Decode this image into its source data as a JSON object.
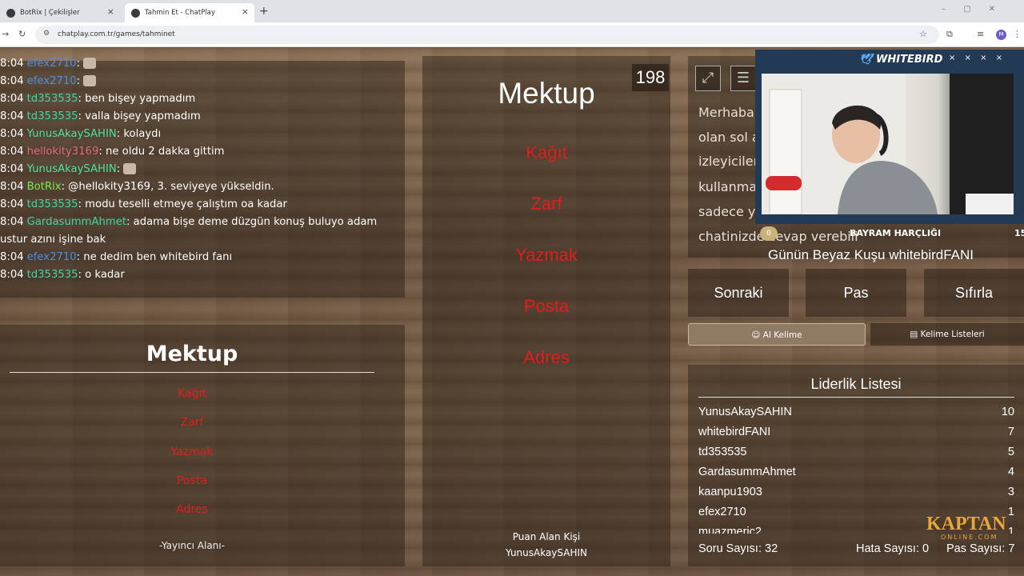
{
  "browser": {
    "tabs": [
      {
        "title": "BotRix | Çekilişler"
      },
      {
        "title": "Tahmin Et - ChatPlay"
      }
    ],
    "url": "chatplay.com.tr/games/tahminet",
    "profile_initial": "M"
  },
  "chat": {
    "messages": [
      {
        "time": "8:04",
        "user": "efex2710",
        "text": ":",
        "color": "#4a8fe8",
        "emote": true
      },
      {
        "time": "8:04",
        "user": "efex2710",
        "text": ":",
        "color": "#4a8fe8",
        "emote": true
      },
      {
        "time": "8:04",
        "user": "td353535",
        "text": ": ben bişey yapmadım",
        "color": "#3fd6a3"
      },
      {
        "time": "8:04",
        "user": "td353535",
        "text": ": valla bişey yapmadım",
        "color": "#3fd6a3"
      },
      {
        "time": "8:04",
        "user": "YunusAkaySAHIN",
        "text": ": kolaydı",
        "color": "#4fe39c"
      },
      {
        "time": "8:04",
        "user": "hellokity3169",
        "text": ": ne oldu 2 dakka gittim",
        "color": "#e86b7a"
      },
      {
        "time": "8:04",
        "user": "YunusAkaySAHIN",
        "text": ":",
        "color": "#4fe39c",
        "emote": true
      },
      {
        "time": "8:04",
        "user": "BotRix",
        "text": ": @hellokity3169, 3. seviyeye yükseldin.",
        "color": "#7ee84f"
      },
      {
        "time": "8:04",
        "user": "td353535",
        "text": ": modu teselli etmeye çalıştım oa kadar",
        "color": "#3fd6a3"
      },
      {
        "time": "8:04",
        "user": "GardasummAhmet",
        "text": ": adama bişe deme düzgün konuş buluyo adam",
        "color": "#3fd6a3"
      },
      {
        "time": "",
        "user": "",
        "text": "ustur azını işine bak",
        "color": "#ffffff"
      },
      {
        "time": "8:04",
        "user": "efex2710",
        "text": ": ne dedim ben whitebird fanı",
        "color": "#4a8fe8"
      },
      {
        "time": "8:04",
        "user": "td353535",
        "text": ": o kadar",
        "color": "#3fd6a3"
      }
    ]
  },
  "streamer": {
    "word": "Mektup",
    "forbidden": [
      "Kağıt",
      "Zarf",
      "Yazmak",
      "Posta",
      "Adres"
    ],
    "footer": "-Yayıncı Alanı-"
  },
  "center": {
    "word": "Mektup",
    "timer": "198",
    "forbidden": [
      "Kağıt",
      "Zarf",
      "Yazmak",
      "Posta",
      "Adres"
    ],
    "scorer_label": "Puan Alan Kişi",
    "scorer": "YunusAkaySAHIN"
  },
  "info": {
    "lines": [
      "Merhaba",
      "olan sol a",
      "izleyiciler",
      "kullanma",
      "sadece y",
      "chatinizde cevap verebili"
    ]
  },
  "buttons": {
    "next": "Sonraki",
    "pass": "Pas",
    "reset": "Sıfırla",
    "ai_word": "AI Kelime",
    "word_lists": "Kelime Listeleri"
  },
  "leaderboard": {
    "title": "Liderlik Listesi",
    "rows": [
      {
        "name": "YunusAkaySAHIN",
        "score": "10"
      },
      {
        "name": "whitebirdFANI",
        "score": "7"
      },
      {
        "name": "td353535",
        "score": "5"
      },
      {
        "name": "GardasummAhmet",
        "score": "4"
      },
      {
        "name": "kaanpu1903",
        "score": "3"
      },
      {
        "name": "efex2710",
        "score": "1"
      },
      {
        "name": "muazmeric2",
        "score": "1"
      }
    ],
    "question_count": "Soru Sayısı: 32",
    "error_count": "Hata Sayısı: 0",
    "pass_count": "Pas Sayısı: 7"
  },
  "overlay": {
    "logo": "WHITEBIRD",
    "close_marks": "× × × ×",
    "title": "BAYRAM HARÇLIĞI",
    "number": "15",
    "badge": "0",
    "message": "Günün Beyaz Kuşu whitebirdFANI",
    "brand": "KAPTAN",
    "brand_sub": "ONLINE.COM"
  },
  "colors": {
    "forbidden_word": "#e01e1e",
    "panel": "rgba(40,30,22,0.45)",
    "brand": "#e9a63a"
  }
}
